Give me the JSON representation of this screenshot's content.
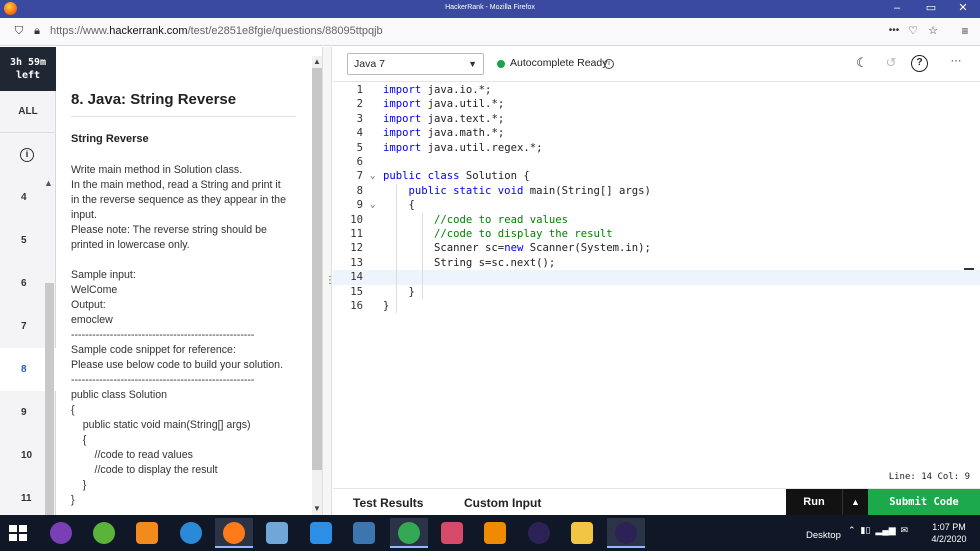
{
  "window": {
    "title": "HackerRank - Mozilla Firefox",
    "minimize": "–",
    "maximize": "▭",
    "close": "✕"
  },
  "browser": {
    "url_prefix": "https://www.",
    "url_domain": "hackerrank.com",
    "url_path": "/test/e2851e8fgie/questions/88095ttpqjb",
    "menu_dots": "•••"
  },
  "rail": {
    "timer_line1": "3h 59m",
    "timer_line2": "left",
    "all_label": "ALL",
    "info_glyph": "i",
    "questions": [
      "4",
      "5",
      "6",
      "7",
      "8",
      "9",
      "10",
      "11"
    ],
    "active_question": "8"
  },
  "problem": {
    "title": "8. Java: String Reverse",
    "subtitle": "String Reverse",
    "lines": [
      "Write main method in Solution class.",
      "In the main method, read a String and print it",
      "in the reverse sequence as they appear in the",
      "input.",
      "Please note: The reverse string should be",
      "printed in lowercase only.",
      "",
      "Sample input:",
      "WelCome",
      "Output:",
      "emoclew",
      "----------------------------------------------------",
      "Sample code snippet for reference:",
      "Please use below code to build your solution.",
      "----------------------------------------------------",
      "public class Solution",
      "{",
      "    public static void main(String[] args)",
      "    {",
      "        //code to read values",
      "        //code to display the result",
      "    }",
      "}"
    ]
  },
  "editor": {
    "language": "Java 7",
    "autocomplete_status": "Autocomplete Ready",
    "status_color": "#1aa34a",
    "theme_icon": "moon-icon",
    "history_icon": "history-icon",
    "help_glyph": "?",
    "more_glyph": "···",
    "code": [
      {
        "n": "1",
        "fold": "",
        "parts": [
          {
            "k": "kw",
            "t": "import"
          },
          {
            "k": "",
            "t": " java.io.*;"
          }
        ]
      },
      {
        "n": "2",
        "fold": "",
        "parts": [
          {
            "k": "kw",
            "t": "import"
          },
          {
            "k": "",
            "t": " java.util.*;"
          }
        ]
      },
      {
        "n": "3",
        "fold": "",
        "parts": [
          {
            "k": "kw",
            "t": "import"
          },
          {
            "k": "",
            "t": " java.text.*;"
          }
        ]
      },
      {
        "n": "4",
        "fold": "",
        "parts": [
          {
            "k": "kw",
            "t": "import"
          },
          {
            "k": "",
            "t": " java.math.*;"
          }
        ]
      },
      {
        "n": "5",
        "fold": "",
        "parts": [
          {
            "k": "kw",
            "t": "import"
          },
          {
            "k": "",
            "t": " java.util.regex.*;"
          }
        ]
      },
      {
        "n": "6",
        "fold": "",
        "parts": []
      },
      {
        "n": "7",
        "fold": "v",
        "parts": [
          {
            "k": "kw",
            "t": "public class"
          },
          {
            "k": "",
            "t": " Solution {"
          }
        ]
      },
      {
        "n": "8",
        "fold": "",
        "parts": [
          {
            "k": "",
            "t": "    "
          },
          {
            "k": "kw",
            "t": "public static void"
          },
          {
            "k": "",
            "t": " main(String[] args)"
          }
        ]
      },
      {
        "n": "9",
        "fold": "v",
        "parts": [
          {
            "k": "",
            "t": "    {"
          }
        ]
      },
      {
        "n": "10",
        "fold": "",
        "parts": [
          {
            "k": "",
            "t": "        "
          },
          {
            "k": "cm",
            "t": "//code to read values"
          }
        ]
      },
      {
        "n": "11",
        "fold": "",
        "parts": [
          {
            "k": "",
            "t": "        "
          },
          {
            "k": "cm",
            "t": "//code to display the result"
          }
        ]
      },
      {
        "n": "12",
        "fold": "",
        "parts": [
          {
            "k": "",
            "t": "        Scanner sc="
          },
          {
            "k": "kw",
            "t": "new"
          },
          {
            "k": "",
            "t": " Scanner(System.in);"
          }
        ]
      },
      {
        "n": "13",
        "fold": "",
        "parts": [
          {
            "k": "",
            "t": "        String s=sc.next();"
          }
        ]
      },
      {
        "n": "14",
        "fold": "",
        "parts": []
      },
      {
        "n": "15",
        "fold": "",
        "parts": [
          {
            "k": "",
            "t": "    }"
          }
        ]
      },
      {
        "n": "16",
        "fold": "",
        "parts": [
          {
            "k": "",
            "t": "}"
          }
        ]
      }
    ],
    "current_line": "14",
    "cursor_status": "Line: 14 Col: 9"
  },
  "bottom": {
    "test_results_tab": "Test Results",
    "custom_input_tab": "Custom Input",
    "run_label": "Run",
    "run_menu_glyph": "▲",
    "submit_label": "Submit Code"
  },
  "taskbar": {
    "apps": [
      {
        "name": "tor-icon",
        "color": "#7b3fb5"
      },
      {
        "name": "utorrent-icon",
        "color": "#5bb33b"
      },
      {
        "name": "sublime-icon",
        "color": "#f28a1c"
      },
      {
        "name": "ie-icon",
        "color": "#2a8ad8"
      },
      {
        "name": "firefox-icon",
        "color": "#ff7a18"
      },
      {
        "name": "notepad-icon",
        "color": "#6fa7d8"
      },
      {
        "name": "app-icon",
        "color": "#2b8fe8"
      },
      {
        "name": "python-icon",
        "color": "#3b76b0"
      },
      {
        "name": "chrome-icon",
        "color": "#34a853"
      },
      {
        "name": "snip-icon",
        "color": "#d84a6a"
      },
      {
        "name": "vlc-icon",
        "color": "#f08a00"
      },
      {
        "name": "eclipse-icon",
        "color": "#2c2255"
      },
      {
        "name": "explorer-icon",
        "color": "#f3c545"
      },
      {
        "name": "eclipse-icon",
        "color": "#2c2255"
      }
    ],
    "desktop_label": "Desktop",
    "time": "1:07 PM",
    "date": "4/2/2020"
  }
}
